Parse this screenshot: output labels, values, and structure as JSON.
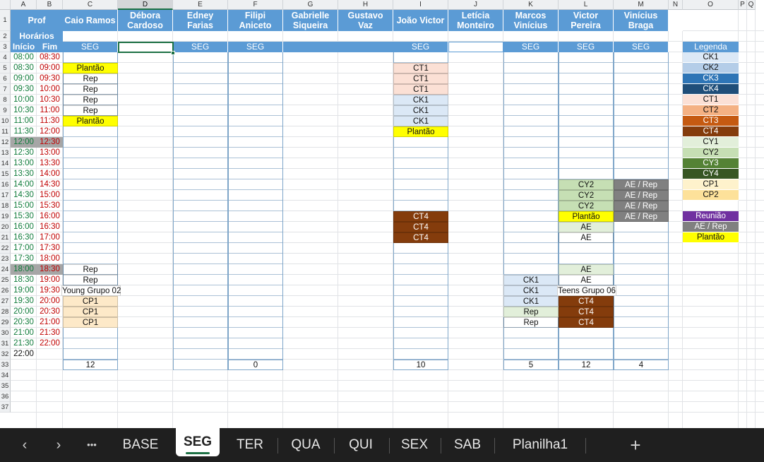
{
  "columns": {
    "A": "A",
    "B": "B",
    "C": "C",
    "D": "D",
    "E": "E",
    "F": "F",
    "G": "G",
    "H": "H",
    "I": "I",
    "J": "J",
    "K": "K",
    "L": "L",
    "M": "M",
    "N": "N",
    "O": "O",
    "P": "P",
    "Q": "Q"
  },
  "rows": [
    "1",
    "2",
    "3",
    "4",
    "5",
    "6",
    "7",
    "8",
    "9",
    "10",
    "11",
    "12",
    "13",
    "14",
    "15",
    "16",
    "17",
    "18",
    "19",
    "20",
    "21",
    "22",
    "23",
    "24",
    "25",
    "26",
    "27",
    "28",
    "29",
    "30",
    "31",
    "32",
    "33",
    "34",
    "35",
    "36",
    "37"
  ],
  "header": {
    "prof": "Prof",
    "horarios": "Horários",
    "inicio": "Início",
    "fim": "Fim",
    "teachers": {
      "C": [
        "Caio Ramos"
      ],
      "D": [
        "Débora",
        "Cardoso"
      ],
      "E": [
        "Edney",
        "Farias"
      ],
      "F": [
        "Filipi",
        "Aniceto"
      ],
      "G": [
        "Gabrielle",
        "Siqueira"
      ],
      "H": [
        "Gustavo",
        "Vaz"
      ],
      "I": [
        "João Victor"
      ],
      "J": [
        "Letícia",
        "Monteiro"
      ],
      "K": [
        "Marcos",
        "Vinícius"
      ],
      "L": [
        "Victor",
        "Pereira"
      ],
      "M": [
        "Vinícius",
        "Braga"
      ]
    },
    "day": {
      "C": "SEG",
      "E": "SEG",
      "F": "SEG",
      "I": "SEG",
      "K": "SEG",
      "L": "SEG",
      "M": "SEG"
    }
  },
  "times": {
    "start": [
      "08:00",
      "08:30",
      "09:00",
      "09:30",
      "10:00",
      "10:30",
      "11:00",
      "11:30",
      "12:00",
      "12:30",
      "13:00",
      "13:30",
      "14:00",
      "14:30",
      "15:00",
      "15:30",
      "16:00",
      "16:30",
      "17:00",
      "17:30",
      "18:00",
      "18:30",
      "19:00",
      "19:30",
      "20:00",
      "20:30",
      "21:00",
      "21:30",
      "22:00"
    ],
    "end": [
      "08:30",
      "09:00",
      "09:30",
      "10:00",
      "10:30",
      "11:00",
      "11:30",
      "12:00",
      "12:30",
      "13:00",
      "13:30",
      "14:00",
      "14:30",
      "15:00",
      "15:30",
      "16:00",
      "16:30",
      "17:00",
      "17:30",
      "18:00",
      "18:30",
      "19:00",
      "19:30",
      "20:00",
      "20:30",
      "21:00",
      "21:30",
      "22:00"
    ]
  },
  "schedule": {
    "C": [
      {
        "r": 5,
        "t": "Plantão",
        "c": "#ffff00"
      },
      {
        "r": 6,
        "t": "Rep"
      },
      {
        "r": 7,
        "t": "Rep"
      },
      {
        "r": 8,
        "t": "Rep"
      },
      {
        "r": 9,
        "t": "Rep"
      },
      {
        "r": 10,
        "t": "Plantão",
        "c": "#ffff00"
      },
      {
        "r": 24,
        "t": "Rep"
      },
      {
        "r": 25,
        "t": "Rep"
      },
      {
        "r": 26,
        "t": "Young Grupo 02"
      },
      {
        "r": 27,
        "t": "CP1",
        "c": "#fde9c8"
      },
      {
        "r": 28,
        "t": "CP1",
        "c": "#fde9c8"
      },
      {
        "r": 29,
        "t": "CP1",
        "c": "#fde9c8"
      }
    ],
    "I": [
      {
        "r": 5,
        "t": "CT1",
        "c": "#fbe0d5"
      },
      {
        "r": 6,
        "t": "CT1",
        "c": "#fbe0d5"
      },
      {
        "r": 7,
        "t": "CT1",
        "c": "#fbe0d5"
      },
      {
        "r": 8,
        "t": "CK1",
        "c": "#dbe8f6"
      },
      {
        "r": 9,
        "t": "CK1",
        "c": "#dbe8f6"
      },
      {
        "r": 10,
        "t": "CK1",
        "c": "#dbe8f6"
      },
      {
        "r": 11,
        "t": "Plantão",
        "c": "#ffff00"
      },
      {
        "r": 19,
        "t": "CT4",
        "c": "#843c0c",
        "f": "#ffffff"
      },
      {
        "r": 20,
        "t": "CT4",
        "c": "#843c0c",
        "f": "#ffffff"
      },
      {
        "r": 21,
        "t": "CT4",
        "c": "#843c0c",
        "f": "#ffffff"
      }
    ],
    "K": [
      {
        "r": 25,
        "t": "CK1",
        "c": "#dbe8f6"
      },
      {
        "r": 26,
        "t": "CK1",
        "c": "#dbe8f6"
      },
      {
        "r": 27,
        "t": "CK1",
        "c": "#dbe8f6"
      },
      {
        "r": 28,
        "t": "Rep",
        "c": "#e2efda"
      },
      {
        "r": 29,
        "t": "Rep"
      }
    ],
    "L": [
      {
        "r": 16,
        "t": "CY2",
        "c": "#c6dfb4"
      },
      {
        "r": 17,
        "t": "CY2",
        "c": "#c6dfb4"
      },
      {
        "r": 18,
        "t": "CY2",
        "c": "#c6dfb4"
      },
      {
        "r": 19,
        "t": "Plantão",
        "c": "#ffff00"
      },
      {
        "r": 20,
        "t": "AE",
        "c": "#e2efda"
      },
      {
        "r": 21,
        "t": "AE"
      },
      {
        "r": 24,
        "t": "AE",
        "c": "#e2efda"
      },
      {
        "r": 25,
        "t": "AE"
      },
      {
        "r": 26,
        "t": "Teens Grupo 06"
      },
      {
        "r": 27,
        "t": "CT4",
        "c": "#843c0c",
        "f": "#ffffff"
      },
      {
        "r": 28,
        "t": "CT4",
        "c": "#843c0c",
        "f": "#ffffff"
      },
      {
        "r": 29,
        "t": "CT4",
        "c": "#843c0c",
        "f": "#ffffff"
      }
    ],
    "M": [
      {
        "r": 16,
        "t": "AE / Rep",
        "c": "#808080",
        "f": "#ffffff"
      },
      {
        "r": 17,
        "t": "AE / Rep",
        "c": "#808080",
        "f": "#ffffff"
      },
      {
        "r": 18,
        "t": "AE / Rep",
        "c": "#808080",
        "f": "#ffffff"
      },
      {
        "r": 19,
        "t": "AE / Rep",
        "c": "#808080",
        "f": "#ffffff"
      }
    ]
  },
  "totals": {
    "C": "12",
    "F": "0",
    "I": "10",
    "K": "5",
    "L": "12",
    "M": "4"
  },
  "legend": {
    "title": "Legenda",
    "items": [
      {
        "r": 4,
        "t": "CK1",
        "c": "#dbe8f6",
        "f": "#111111"
      },
      {
        "r": 5,
        "t": "CK2",
        "c": "#b4cde8",
        "f": "#111111"
      },
      {
        "r": 6,
        "t": "CK3",
        "c": "#2e75b6",
        "f": "#ffffff"
      },
      {
        "r": 7,
        "t": "CK4",
        "c": "#1f4e79",
        "f": "#ffffff"
      },
      {
        "r": 8,
        "t": "CT1",
        "c": "#fbe0d5",
        "f": "#111111"
      },
      {
        "r": 9,
        "t": "CT2",
        "c": "#f4b183",
        "f": "#111111"
      },
      {
        "r": 10,
        "t": "CT3",
        "c": "#c55a11",
        "f": "#ffffff"
      },
      {
        "r": 11,
        "t": "CT4",
        "c": "#843c0c",
        "f": "#ffffff"
      },
      {
        "r": 12,
        "t": "CY1",
        "c": "#e2efda",
        "f": "#111111"
      },
      {
        "r": 13,
        "t": "CY2",
        "c": "#c6dfb4",
        "f": "#111111"
      },
      {
        "r": 14,
        "t": "CY3",
        "c": "#548235",
        "f": "#ffffff"
      },
      {
        "r": 15,
        "t": "CY4",
        "c": "#375623",
        "f": "#ffffff"
      },
      {
        "r": 16,
        "t": "CP1",
        "c": "#fef2cc",
        "f": "#111111"
      },
      {
        "r": 17,
        "t": "CP2",
        "c": "#fde19a",
        "f": "#111111"
      },
      {
        "r": 19,
        "t": "Reunião",
        "c": "#7030a0",
        "f": "#ffffff"
      },
      {
        "r": 20,
        "t": "AE / Rep",
        "c": "#808080",
        "f": "#ffffff"
      },
      {
        "r": 21,
        "t": "Plantão",
        "c": "#ffff00",
        "f": "#111111"
      }
    ]
  },
  "colors": {
    "header_blue": "#5b9bd5",
    "inicio_green": "#0f7b3a",
    "fim_red": "#c00000",
    "grid": "#e1e3e6",
    "box_border": "#7fa6c9",
    "active_tab_underline": "#1e7145",
    "tabbar_bg": "#1f1f1f"
  },
  "tabs": [
    "BASE",
    "SEG",
    "TER",
    "QUA",
    "QUI",
    "SEX",
    "SAB",
    "Planilha1"
  ],
  "active_tab": "SEG",
  "nav": {
    "prev": "‹",
    "next": "›",
    "more": "•••",
    "add": "+"
  }
}
